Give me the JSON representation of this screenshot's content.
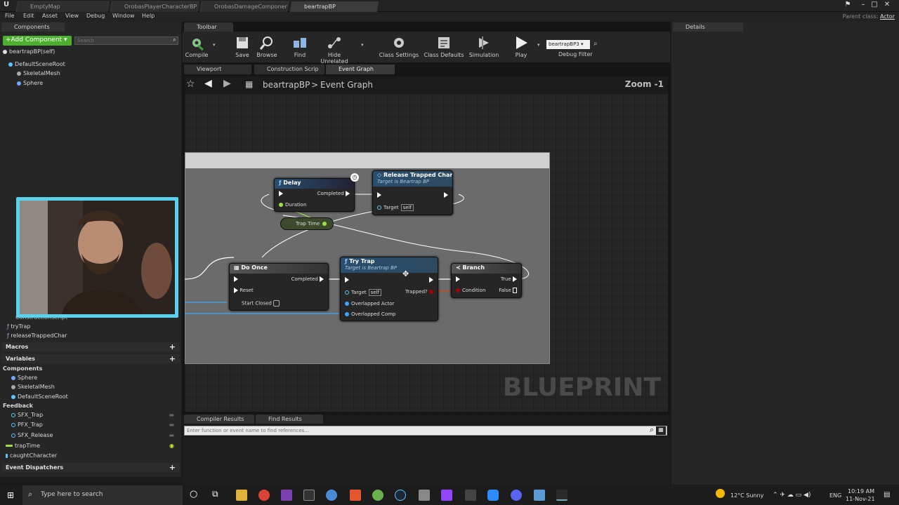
{
  "window": {
    "tabs": [
      "EmptyMap",
      "OrobasPlayerCharacterBP",
      "OrobasDamageComponent",
      "beartrapBP"
    ],
    "parent_class_label": "Parent class:",
    "parent_class_value": "Actor"
  },
  "menu": [
    "File",
    "Edit",
    "Asset",
    "View",
    "Debug",
    "Window",
    "Help"
  ],
  "components": {
    "tab": "Components",
    "add_button": "+Add Component ▾",
    "search_placeholder": "Search",
    "self_item": "beartrapBP(self)",
    "tree": [
      "DefaultSceneRoot",
      "SkeletalMesh",
      "Sphere"
    ]
  },
  "toolbar": {
    "tab": "Toolbar",
    "buttons": [
      "Compile",
      "Save",
      "Browse",
      "Find",
      "Hide Unrelated",
      "Class Settings",
      "Class Defaults",
      "Simulation",
      "Play"
    ],
    "debug_select": "beartrapBP3 ▾",
    "debug_label": "Debug Filter"
  },
  "editor_tabs": [
    "Viewport",
    "Construction Scrip",
    "Event Graph"
  ],
  "graph": {
    "crumb_root": "beartrapBP",
    "crumb_sep": ">",
    "crumb_current": "Event Graph",
    "zoom": "Zoom -1",
    "watermark": "BLUEPRINT"
  },
  "nodes": {
    "delay": {
      "title": "Delay",
      "out": "Completed",
      "in": "Duration"
    },
    "release": {
      "title": "Release Trapped Char",
      "sub": "Target is Beartrap BP",
      "target": "Target",
      "self": "self"
    },
    "trap_time": "Trap Time",
    "do_once": {
      "title": "Do Once",
      "completed": "Completed",
      "reset": "Reset",
      "start_closed": "Start Closed"
    },
    "try_trap": {
      "title": "Try Trap",
      "sub": "Target is Beartrap BP",
      "target": "Target",
      "self": "self",
      "trapped": "Trapped?",
      "actor": "Overlapped Actor",
      "comp": "Overlapped Comp"
    },
    "branch": {
      "title": "Branch",
      "true_label": "True",
      "condition": "Condition",
      "false_label": "False"
    }
  },
  "my_blueprint": {
    "functions": [
      "ConstructionScript",
      "tryTrap",
      "releaseTrappedChar"
    ],
    "macros_label": "Macros",
    "variables_label": "Variables",
    "components_label": "Components",
    "component_vars": [
      "Sphere",
      "SkeletalMesh",
      "DefaultSceneRoot"
    ],
    "feedback_label": "Feedback",
    "feedback_vars": [
      "SFX_Trap",
      "PFX_Trap",
      "SFX_Release"
    ],
    "other_vars": [
      "trapTime",
      "caughtCharacter"
    ],
    "dispatchers_label": "Event Dispatchers"
  },
  "bottom": {
    "tabs": [
      "Compiler Results",
      "Find Results"
    ],
    "find_placeholder": "Enter function or event name to find references..."
  },
  "details": {
    "tab": "Details"
  },
  "taskbar": {
    "search_placeholder": "Type here to search",
    "weather": "12°C  Sunny",
    "lang": "ENG",
    "time": "10:19 AM",
    "date": "11-Nov-21"
  },
  "colors": {
    "accent_green": "#4caf2e",
    "webcam_border": "#5cd1ec",
    "node_func": "#2a4e6e"
  }
}
